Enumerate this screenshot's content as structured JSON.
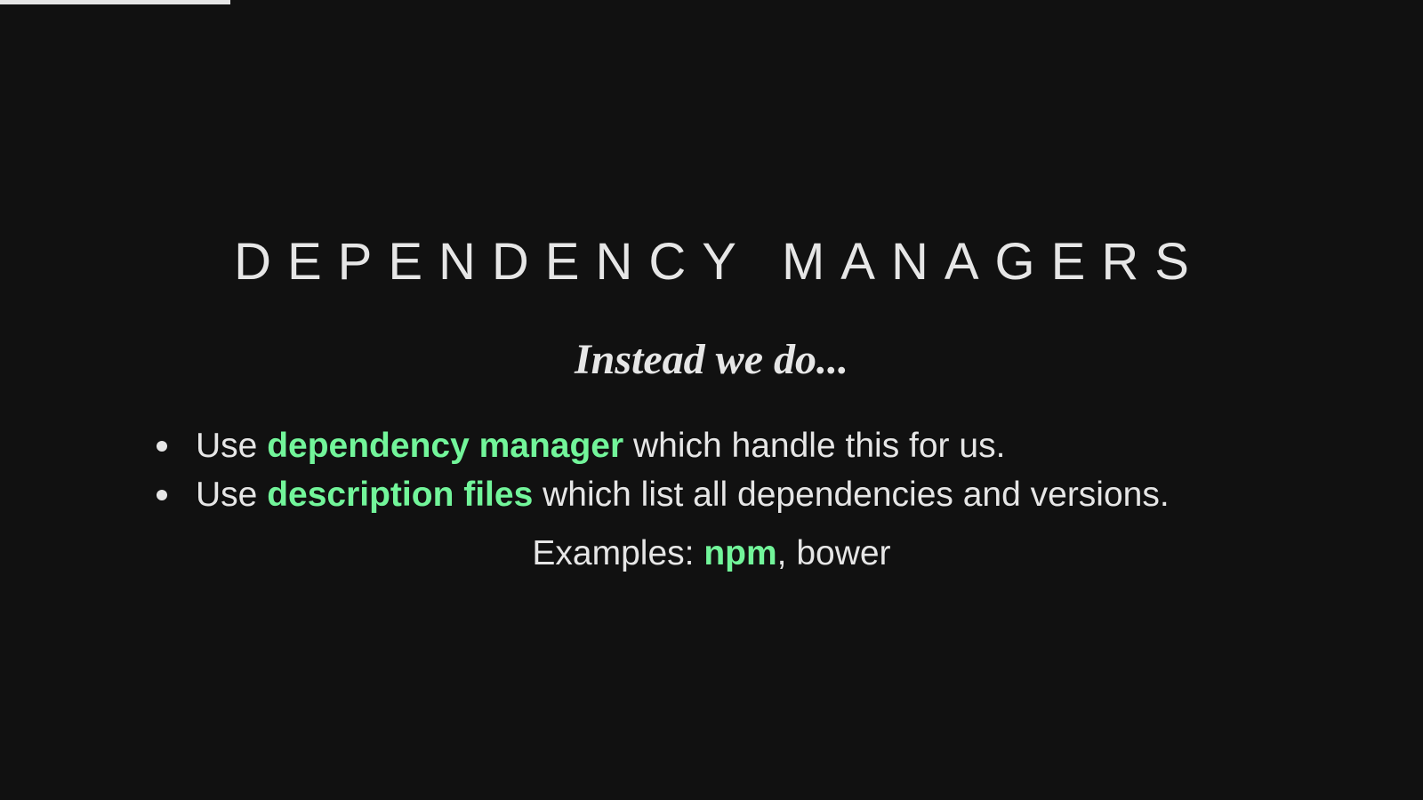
{
  "progress": {
    "fraction": 0.162
  },
  "slide": {
    "title": "DEPENDENCY MANAGERS",
    "subtitle": "Instead we do...",
    "bullets": [
      {
        "prefix": "Use ",
        "highlight": "dependency manager",
        "suffix": " which handle this for us."
      },
      {
        "prefix": "Use ",
        "highlight": "description files",
        "suffix": " which list all dependencies and versions."
      }
    ],
    "examples": {
      "label": "Examples: ",
      "highlight": "npm",
      "rest": ", bower"
    }
  },
  "colors": {
    "background": "#111111",
    "text": "#e6e6e6",
    "accent": "#72f59a"
  }
}
